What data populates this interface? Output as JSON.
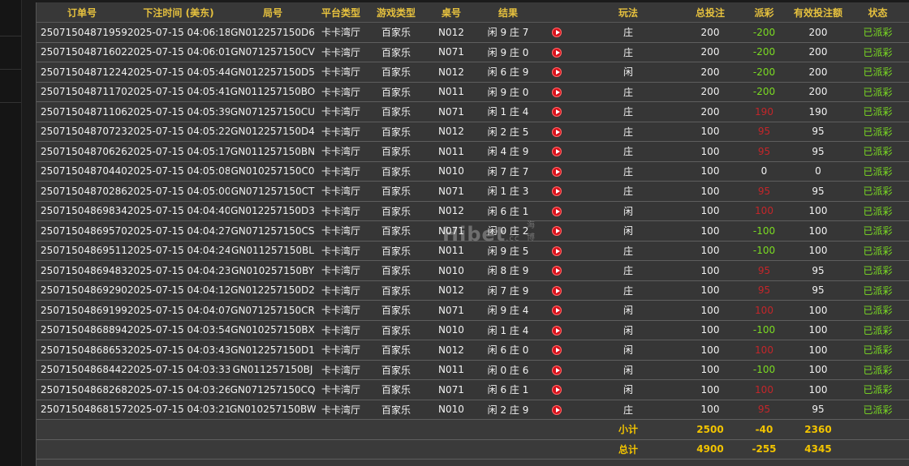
{
  "headers": {
    "order_no": "订单号",
    "bet_time": "下注时间 (美东)",
    "round_no": "局号",
    "platform": "平台类型",
    "game_type": "游戏类型",
    "table_no": "桌号",
    "result": "结果",
    "replay": "",
    "play": "玩法",
    "total_bet": "总投注",
    "payout": "派彩",
    "valid_bet": "有效投注额",
    "status": "状态"
  },
  "rows": [
    {
      "order": "250715048719591",
      "time": "2025-07-15 04:06:18",
      "round": "GN012257150D6",
      "platform": "卡卡湾厅",
      "game": "百家乐",
      "table": "N012",
      "result": "闲 9 庄 7",
      "play": "庄",
      "bet": "200",
      "payout": "-200",
      "payout_color": "green",
      "valid": "200",
      "status": "已派彩"
    },
    {
      "order": "250715048716025",
      "time": "2025-07-15 04:06:01",
      "round": "GN071257150CV",
      "platform": "卡卡湾厅",
      "game": "百家乐",
      "table": "N071",
      "result": "闲 9 庄 0",
      "play": "庄",
      "bet": "200",
      "payout": "-200",
      "payout_color": "green",
      "valid": "200",
      "status": "已派彩"
    },
    {
      "order": "250715048712240",
      "time": "2025-07-15 04:05:44",
      "round": "GN012257150D5",
      "platform": "卡卡湾厅",
      "game": "百家乐",
      "table": "N012",
      "result": "闲 6 庄 9",
      "play": "闲",
      "bet": "200",
      "payout": "-200",
      "payout_color": "green",
      "valid": "200",
      "status": "已派彩"
    },
    {
      "order": "250715048711705",
      "time": "2025-07-15 04:05:41",
      "round": "GN011257150BO",
      "platform": "卡卡湾厅",
      "game": "百家乐",
      "table": "N011",
      "result": "闲 9 庄 0",
      "play": "庄",
      "bet": "200",
      "payout": "-200",
      "payout_color": "green",
      "valid": "200",
      "status": "已派彩"
    },
    {
      "order": "250715048711064",
      "time": "2025-07-15 04:05:39",
      "round": "GN071257150CU",
      "platform": "卡卡湾厅",
      "game": "百家乐",
      "table": "N071",
      "result": "闲 1 庄 4",
      "play": "庄",
      "bet": "200",
      "payout": "190",
      "payout_color": "red",
      "valid": "190",
      "status": "已派彩"
    },
    {
      "order": "250715048707232",
      "time": "2025-07-15 04:05:22",
      "round": "GN012257150D4",
      "platform": "卡卡湾厅",
      "game": "百家乐",
      "table": "N012",
      "result": "闲 2 庄 5",
      "play": "庄",
      "bet": "100",
      "payout": "95",
      "payout_color": "red",
      "valid": "95",
      "status": "已派彩"
    },
    {
      "order": "250715048706268",
      "time": "2025-07-15 04:05:17",
      "round": "GN011257150BN",
      "platform": "卡卡湾厅",
      "game": "百家乐",
      "table": "N011",
      "result": "闲 4 庄 9",
      "play": "庄",
      "bet": "100",
      "payout": "95",
      "payout_color": "red",
      "valid": "95",
      "status": "已派彩"
    },
    {
      "order": "250715048704400",
      "time": "2025-07-15 04:05:08",
      "round": "GN010257150C0",
      "platform": "卡卡湾厅",
      "game": "百家乐",
      "table": "N010",
      "result": "闲 7 庄 7",
      "play": "庄",
      "bet": "100",
      "payout": "0",
      "payout_color": "white",
      "valid": "0",
      "status": "已派彩"
    },
    {
      "order": "250715048702863",
      "time": "2025-07-15 04:05:00",
      "round": "GN071257150CT",
      "platform": "卡卡湾厅",
      "game": "百家乐",
      "table": "N071",
      "result": "闲 1 庄 3",
      "play": "庄",
      "bet": "100",
      "payout": "95",
      "payout_color": "red",
      "valid": "95",
      "status": "已派彩"
    },
    {
      "order": "250715048698341",
      "time": "2025-07-15 04:04:40",
      "round": "GN012257150D3",
      "platform": "卡卡湾厅",
      "game": "百家乐",
      "table": "N012",
      "result": "闲 6 庄 1",
      "play": "闲",
      "bet": "100",
      "payout": "100",
      "payout_color": "red",
      "valid": "100",
      "status": "已派彩"
    },
    {
      "order": "250715048695702",
      "time": "2025-07-15 04:04:27",
      "round": "GN071257150CS",
      "platform": "卡卡湾厅",
      "game": "百家乐",
      "table": "N071",
      "result": "闲 0 庄 2",
      "play": "闲",
      "bet": "100",
      "payout": "-100",
      "payout_color": "green",
      "valid": "100",
      "status": "已派彩"
    },
    {
      "order": "250715048695110",
      "time": "2025-07-15 04:04:24",
      "round": "GN011257150BL",
      "platform": "卡卡湾厅",
      "game": "百家乐",
      "table": "N011",
      "result": "闲 9 庄 5",
      "play": "庄",
      "bet": "100",
      "payout": "-100",
      "payout_color": "green",
      "valid": "100",
      "status": "已派彩"
    },
    {
      "order": "250715048694830",
      "time": "2025-07-15 04:04:23",
      "round": "GN010257150BY",
      "platform": "卡卡湾厅",
      "game": "百家乐",
      "table": "N010",
      "result": "闲 8 庄 9",
      "play": "庄",
      "bet": "100",
      "payout": "95",
      "payout_color": "red",
      "valid": "95",
      "status": "已派彩"
    },
    {
      "order": "250715048692909",
      "time": "2025-07-15 04:04:12",
      "round": "GN012257150D2",
      "platform": "卡卡湾厅",
      "game": "百家乐",
      "table": "N012",
      "result": "闲 7 庄 9",
      "play": "庄",
      "bet": "100",
      "payout": "95",
      "payout_color": "red",
      "valid": "95",
      "status": "已派彩"
    },
    {
      "order": "250715048691990",
      "time": "2025-07-15 04:04:07",
      "round": "GN071257150CR",
      "platform": "卡卡湾厅",
      "game": "百家乐",
      "table": "N071",
      "result": "闲 9 庄 4",
      "play": "闲",
      "bet": "100",
      "payout": "100",
      "payout_color": "red",
      "valid": "100",
      "status": "已派彩"
    },
    {
      "order": "250715048688940",
      "time": "2025-07-15 04:03:54",
      "round": "GN010257150BX",
      "platform": "卡卡湾厅",
      "game": "百家乐",
      "table": "N010",
      "result": "闲 1 庄 4",
      "play": "闲",
      "bet": "100",
      "payout": "-100",
      "payout_color": "green",
      "valid": "100",
      "status": "已派彩"
    },
    {
      "order": "250715048686536",
      "time": "2025-07-15 04:03:43",
      "round": "GN012257150D1",
      "platform": "卡卡湾厅",
      "game": "百家乐",
      "table": "N012",
      "result": "闲 6 庄 0",
      "play": "闲",
      "bet": "100",
      "payout": "100",
      "payout_color": "red",
      "valid": "100",
      "status": "已派彩"
    },
    {
      "order": "250715048684428",
      "time": "2025-07-15 04:03:33",
      "round": "GN011257150BJ",
      "platform": "卡卡湾厅",
      "game": "百家乐",
      "table": "N011",
      "result": "闲 0 庄 6",
      "play": "闲",
      "bet": "100",
      "payout": "-100",
      "payout_color": "green",
      "valid": "100",
      "status": "已派彩"
    },
    {
      "order": "250715048682686",
      "time": "2025-07-15 04:03:26",
      "round": "GN071257150CQ",
      "platform": "卡卡湾厅",
      "game": "百家乐",
      "table": "N071",
      "result": "闲 6 庄 1",
      "play": "闲",
      "bet": "100",
      "payout": "100",
      "payout_color": "red",
      "valid": "100",
      "status": "已派彩"
    },
    {
      "order": "250715048681579",
      "time": "2025-07-15 04:03:21",
      "round": "GN010257150BW",
      "platform": "卡卡湾厅",
      "game": "百家乐",
      "table": "N010",
      "result": "闲 2 庄 9",
      "play": "庄",
      "bet": "100",
      "payout": "95",
      "payout_color": "red",
      "valid": "95",
      "status": "已派彩"
    }
  ],
  "subtotal": {
    "label": "小计",
    "bet": "2500",
    "payout": "-40",
    "valid": "2360"
  },
  "total": {
    "label": "总计",
    "bet": "4900",
    "payout": "-255",
    "valid": "4345"
  },
  "watermark": {
    "main": "Hibet",
    "suffix": ".cc",
    "cn": "海博"
  },
  "colors": {
    "header": "#e6c13e",
    "positive_status": "#7bdc22",
    "red_payout": "#c4262a",
    "sum_text": "#f2c400"
  }
}
